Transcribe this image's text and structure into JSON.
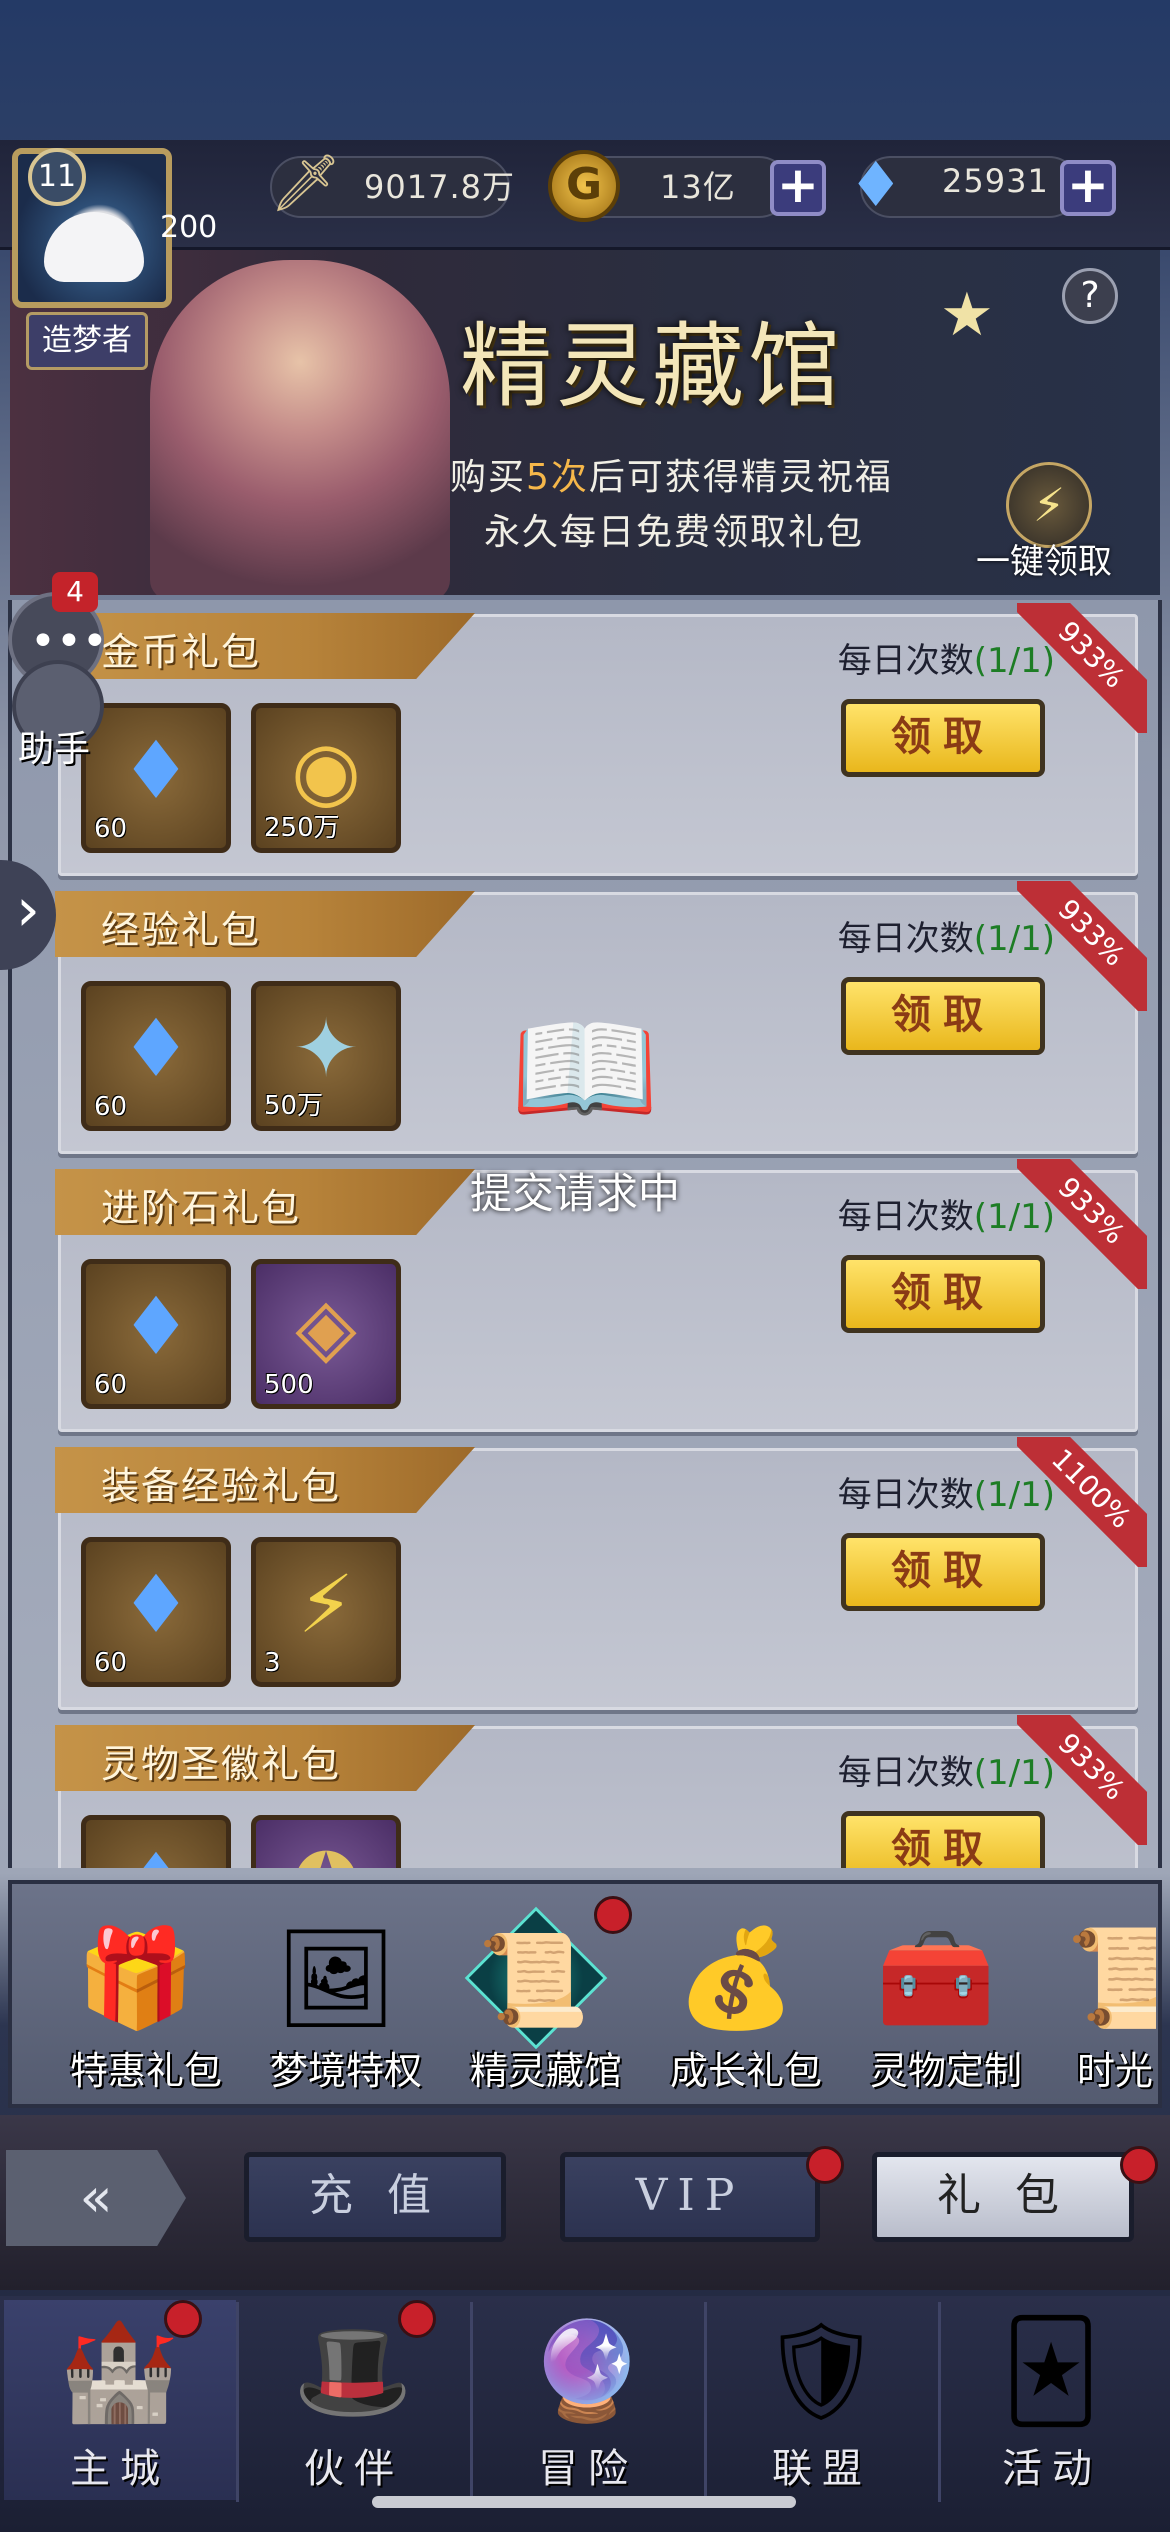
{
  "player": {
    "level": "11",
    "level_sub": "200",
    "title": "造梦者"
  },
  "resources": {
    "power": "9017.8万",
    "gold": "13亿",
    "diamonds": "25931"
  },
  "banner": {
    "title": "精灵藏馆",
    "line1_prefix": "购买",
    "line1_highlight": "5次",
    "line1_suffix": "后可获得精灵祝福",
    "line2": "永久每日免费领取礼包",
    "claim_all": "一键领取",
    "help": "?"
  },
  "side": {
    "chat_badge": "4",
    "helper_label": "助手"
  },
  "loading": {
    "text": "提交请求中"
  },
  "packs": [
    {
      "title": "金币礼包",
      "count_label": "每日次数",
      "count": "(1/1)",
      "ribbon": "933%",
      "button": "领取",
      "items": [
        {
          "icon": "diamond-icon",
          "qty": "60"
        },
        {
          "icon": "gold-coin-icon",
          "qty": "250万"
        }
      ]
    },
    {
      "title": "经验礼包",
      "count_label": "每日次数",
      "count": "(1/1)",
      "ribbon": "933%",
      "button": "领取",
      "items": [
        {
          "icon": "diamond-icon",
          "qty": "60"
        },
        {
          "icon": "exp-star-icon",
          "qty": "50万"
        }
      ]
    },
    {
      "title": "进阶石礼包",
      "count_label": "每日次数",
      "count": "(1/1)",
      "ribbon": "933%",
      "button": "领取",
      "items": [
        {
          "icon": "diamond-icon",
          "qty": "60"
        },
        {
          "icon": "advance-stone-icon",
          "qty": "500"
        }
      ]
    },
    {
      "title": "装备经验礼包",
      "count_label": "每日次数",
      "count": "(1/1)",
      "ribbon": "1100%",
      "button": "领取",
      "items": [
        {
          "icon": "diamond-icon",
          "qty": "60"
        },
        {
          "icon": "lightning-badge-icon",
          "qty": "3"
        }
      ]
    },
    {
      "title": "灵物圣徽礼包",
      "count_label": "每日次数",
      "count": "(1/1)",
      "ribbon": "933%",
      "button": "领取",
      "items": [
        {
          "icon": "diamond-icon",
          "qty": ""
        },
        {
          "icon": "emblem-icon",
          "qty": ""
        }
      ]
    }
  ],
  "tabs": [
    {
      "label": "特惠礼包",
      "icon": "gift-box-icon"
    },
    {
      "label": "梦境特权",
      "icon": "portrait-frame-icon"
    },
    {
      "label": "精灵藏馆",
      "icon": "spirit-hall-icon"
    },
    {
      "label": "成长礼包",
      "icon": "treasure-chest-icon"
    },
    {
      "label": "灵物定制",
      "icon": "custom-chest-icon"
    },
    {
      "label": "时光",
      "icon": "scroll-icon"
    }
  ],
  "categories": {
    "recharge": "充 值",
    "vip": "VIP",
    "gift": "礼 包"
  },
  "nav": [
    {
      "label": "主城",
      "icon": "castle-icon"
    },
    {
      "label": "伙伴",
      "icon": "witch-hat-icon"
    },
    {
      "label": "冒险",
      "icon": "portal-icon"
    },
    {
      "label": "联盟",
      "icon": "shield-icon"
    },
    {
      "label": "活动",
      "icon": "cards-icon"
    }
  ],
  "colors": {
    "accent_gold": "#e9b71c",
    "ribbon_red": "#bd2f36",
    "count_green": "#1d7d25"
  }
}
